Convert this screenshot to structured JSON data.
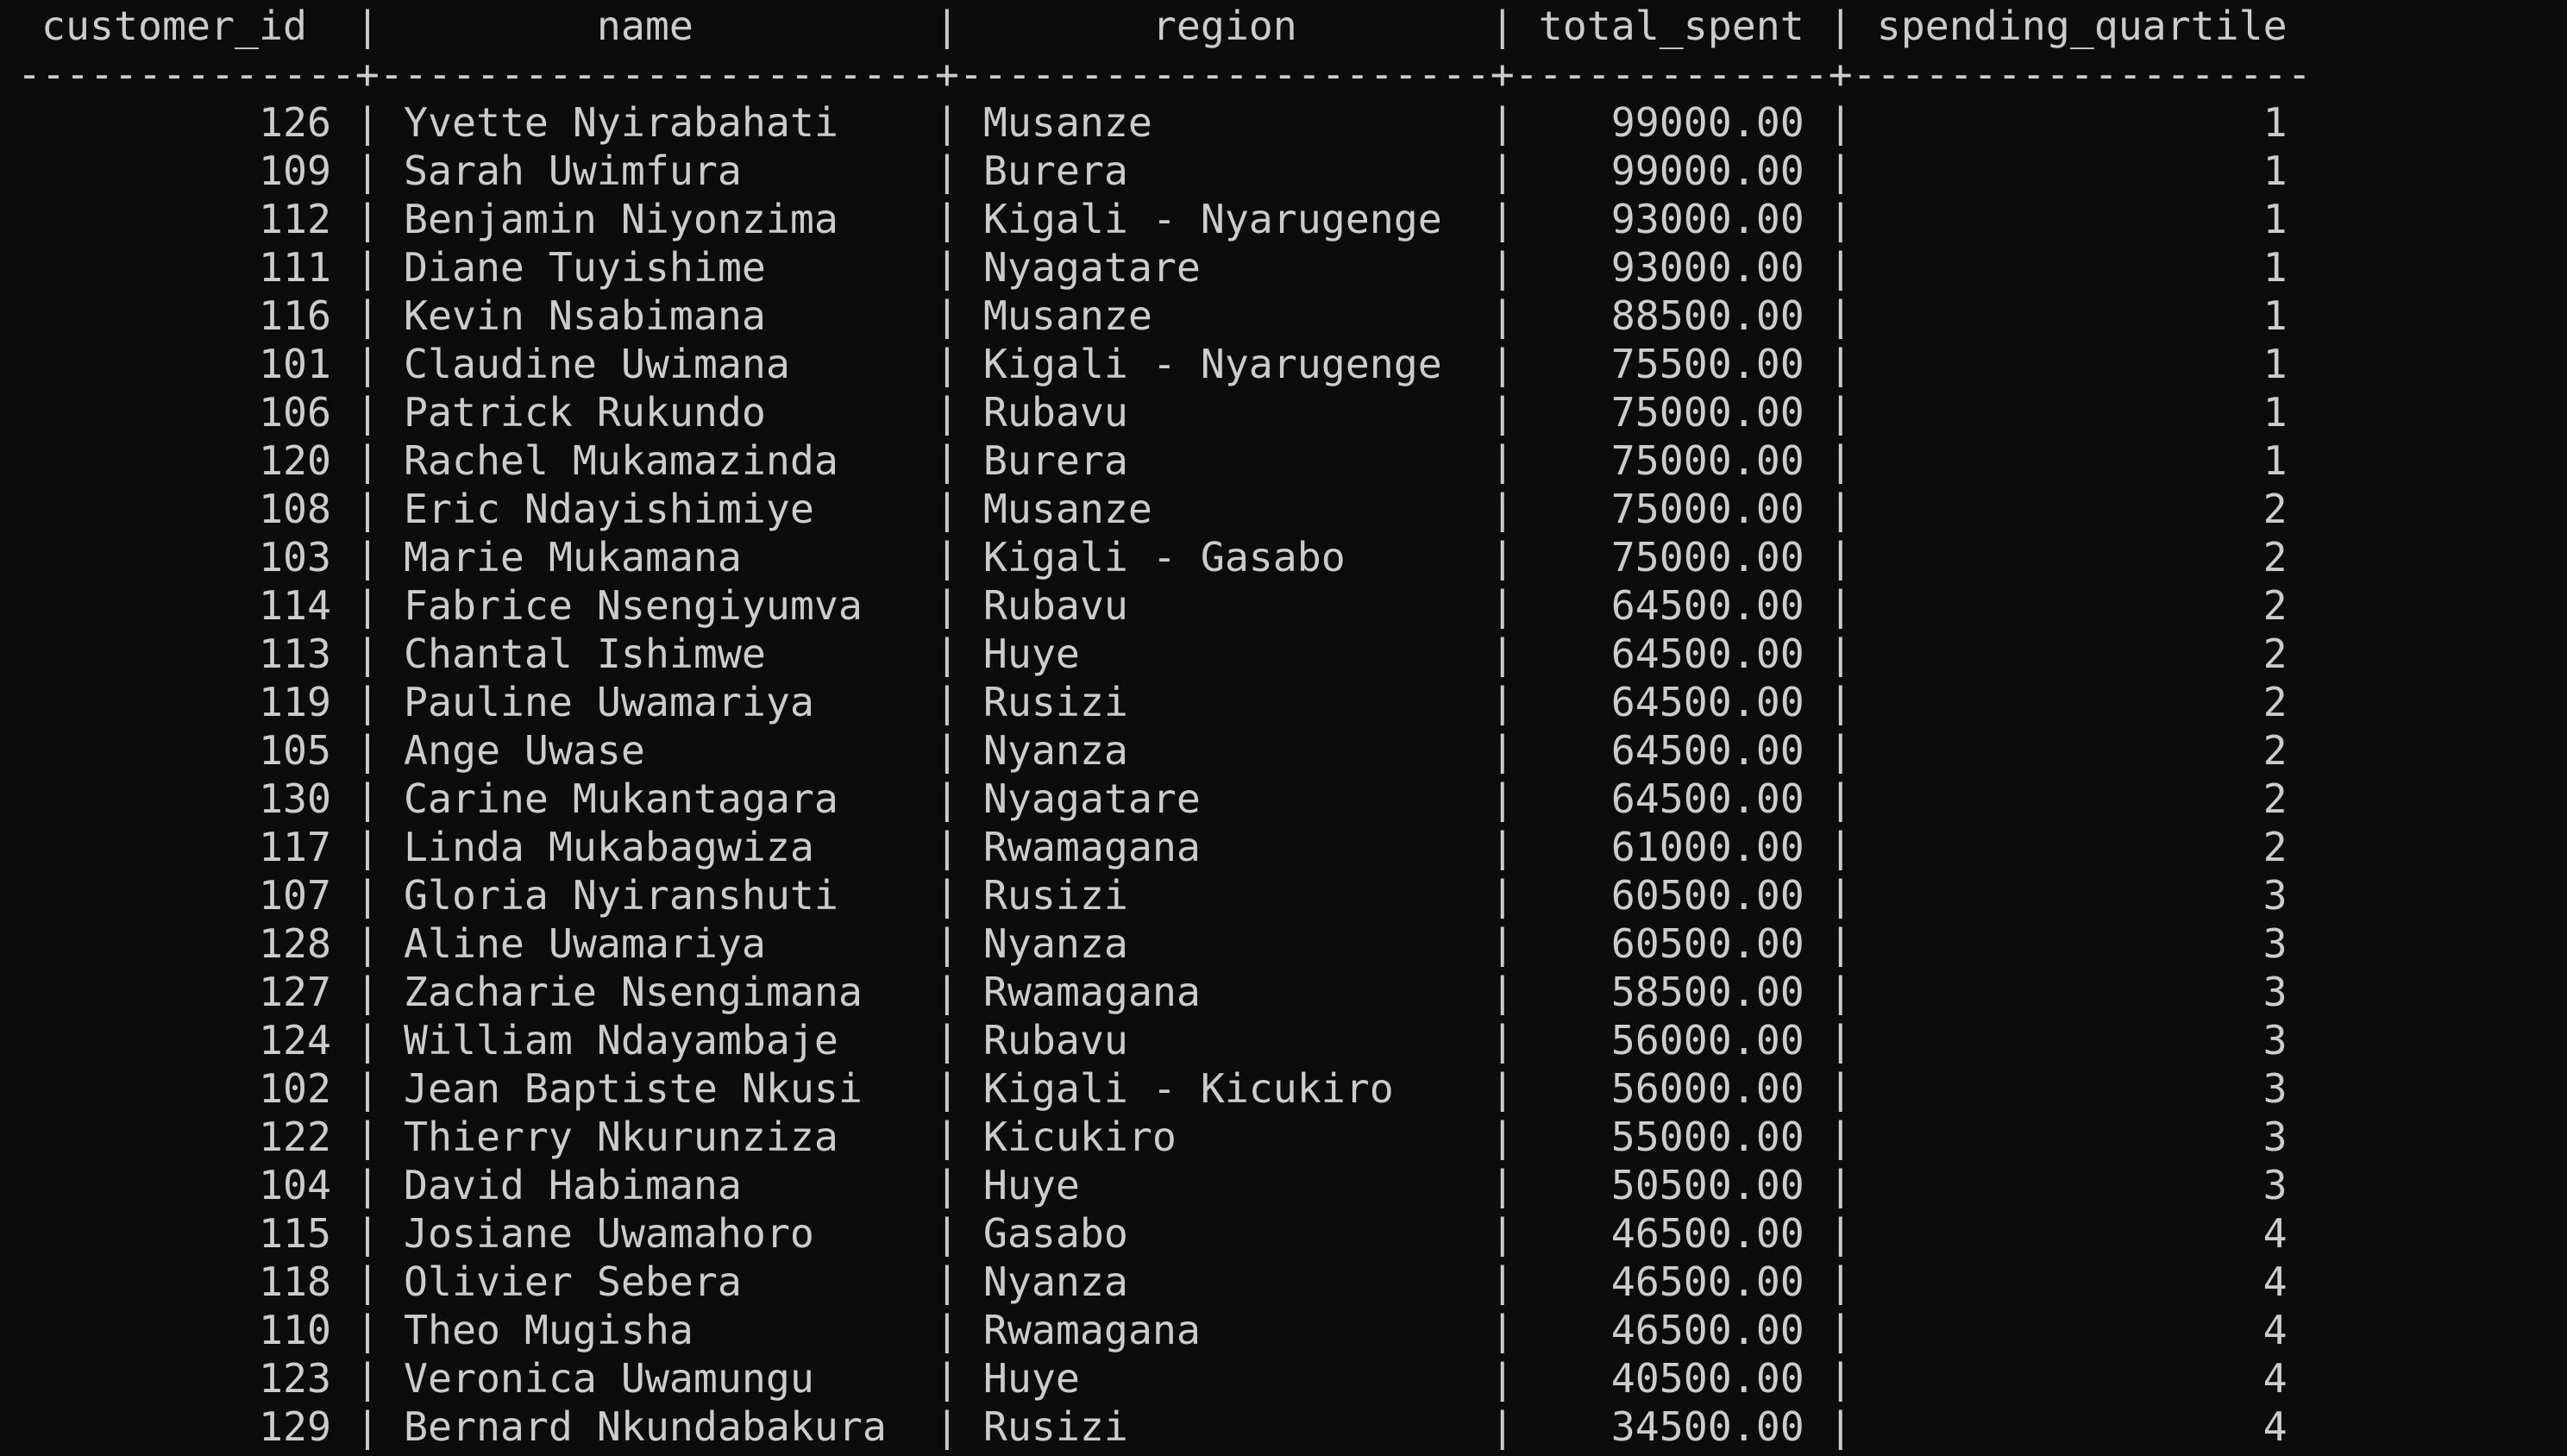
{
  "terminal": {
    "background_color": "#0c0c0c",
    "text_color": "#cccccc"
  },
  "query_result": {
    "columns": [
      {
        "key": "customer_id",
        "label": "customer_id",
        "width": 12,
        "align": "right"
      },
      {
        "key": "name",
        "label": "name",
        "width": 21,
        "align": "left"
      },
      {
        "key": "region",
        "label": "region",
        "width": 20,
        "align": "left"
      },
      {
        "key": "total_spent",
        "label": "total_spent",
        "width": 11,
        "align": "right"
      },
      {
        "key": "spending_quartile",
        "label": "spending_quartile",
        "width": 17,
        "align": "right"
      }
    ],
    "rows": [
      {
        "customer_id": "126",
        "name": "Yvette Nyirabahati",
        "region": "Musanze",
        "total_spent": "99000.00",
        "spending_quartile": "1"
      },
      {
        "customer_id": "109",
        "name": "Sarah Uwimfura",
        "region": "Burera",
        "total_spent": "99000.00",
        "spending_quartile": "1"
      },
      {
        "customer_id": "112",
        "name": "Benjamin Niyonzima",
        "region": "Kigali - Nyarugenge",
        "total_spent": "93000.00",
        "spending_quartile": "1"
      },
      {
        "customer_id": "111",
        "name": "Diane Tuyishime",
        "region": "Nyagatare",
        "total_spent": "93000.00",
        "spending_quartile": "1"
      },
      {
        "customer_id": "116",
        "name": "Kevin Nsabimana",
        "region": "Musanze",
        "total_spent": "88500.00",
        "spending_quartile": "1"
      },
      {
        "customer_id": "101",
        "name": "Claudine Uwimana",
        "region": "Kigali - Nyarugenge",
        "total_spent": "75500.00",
        "spending_quartile": "1"
      },
      {
        "customer_id": "106",
        "name": "Patrick Rukundo",
        "region": "Rubavu",
        "total_spent": "75000.00",
        "spending_quartile": "1"
      },
      {
        "customer_id": "120",
        "name": "Rachel Mukamazinda",
        "region": "Burera",
        "total_spent": "75000.00",
        "spending_quartile": "1"
      },
      {
        "customer_id": "108",
        "name": "Eric Ndayishimiye",
        "region": "Musanze",
        "total_spent": "75000.00",
        "spending_quartile": "2"
      },
      {
        "customer_id": "103",
        "name": "Marie Mukamana",
        "region": "Kigali - Gasabo",
        "total_spent": "75000.00",
        "spending_quartile": "2"
      },
      {
        "customer_id": "114",
        "name": "Fabrice Nsengiyumva",
        "region": "Rubavu",
        "total_spent": "64500.00",
        "spending_quartile": "2"
      },
      {
        "customer_id": "113",
        "name": "Chantal Ishimwe",
        "region": "Huye",
        "total_spent": "64500.00",
        "spending_quartile": "2"
      },
      {
        "customer_id": "119",
        "name": "Pauline Uwamariya",
        "region": "Rusizi",
        "total_spent": "64500.00",
        "spending_quartile": "2"
      },
      {
        "customer_id": "105",
        "name": "Ange Uwase",
        "region": "Nyanza",
        "total_spent": "64500.00",
        "spending_quartile": "2"
      },
      {
        "customer_id": "130",
        "name": "Carine Mukantagara",
        "region": "Nyagatare",
        "total_spent": "64500.00",
        "spending_quartile": "2"
      },
      {
        "customer_id": "117",
        "name": "Linda Mukabagwiza",
        "region": "Rwamagana",
        "total_spent": "61000.00",
        "spending_quartile": "2"
      },
      {
        "customer_id": "107",
        "name": "Gloria Nyiranshuti",
        "region": "Rusizi",
        "total_spent": "60500.00",
        "spending_quartile": "3"
      },
      {
        "customer_id": "128",
        "name": "Aline Uwamariya",
        "region": "Nyanza",
        "total_spent": "60500.00",
        "spending_quartile": "3"
      },
      {
        "customer_id": "127",
        "name": "Zacharie Nsengimana",
        "region": "Rwamagana",
        "total_spent": "58500.00",
        "spending_quartile": "3"
      },
      {
        "customer_id": "124",
        "name": "William Ndayambaje",
        "region": "Rubavu",
        "total_spent": "56000.00",
        "spending_quartile": "3"
      },
      {
        "customer_id": "102",
        "name": "Jean Baptiste Nkusi",
        "region": "Kigali - Kicukiro",
        "total_spent": "56000.00",
        "spending_quartile": "3"
      },
      {
        "customer_id": "122",
        "name": "Thierry Nkurunziza",
        "region": "Kicukiro",
        "total_spent": "55000.00",
        "spending_quartile": "3"
      },
      {
        "customer_id": "104",
        "name": "David Habimana",
        "region": "Huye",
        "total_spent": "50500.00",
        "spending_quartile": "3"
      },
      {
        "customer_id": "115",
        "name": "Josiane Uwamahoro",
        "region": "Gasabo",
        "total_spent": "46500.00",
        "spending_quartile": "4"
      },
      {
        "customer_id": "118",
        "name": "Olivier Sebera",
        "region": "Nyanza",
        "total_spent": "46500.00",
        "spending_quartile": "4"
      },
      {
        "customer_id": "110",
        "name": "Theo Mugisha",
        "region": "Rwamagana",
        "total_spent": "46500.00",
        "spending_quartile": "4"
      },
      {
        "customer_id": "123",
        "name": "Veronica Uwamungu",
        "region": "Huye",
        "total_spent": "40500.00",
        "spending_quartile": "4"
      },
      {
        "customer_id": "129",
        "name": "Bernard Nkundabakura",
        "region": "Rusizi",
        "total_spent": "34500.00",
        "spending_quartile": "4"
      }
    ]
  }
}
